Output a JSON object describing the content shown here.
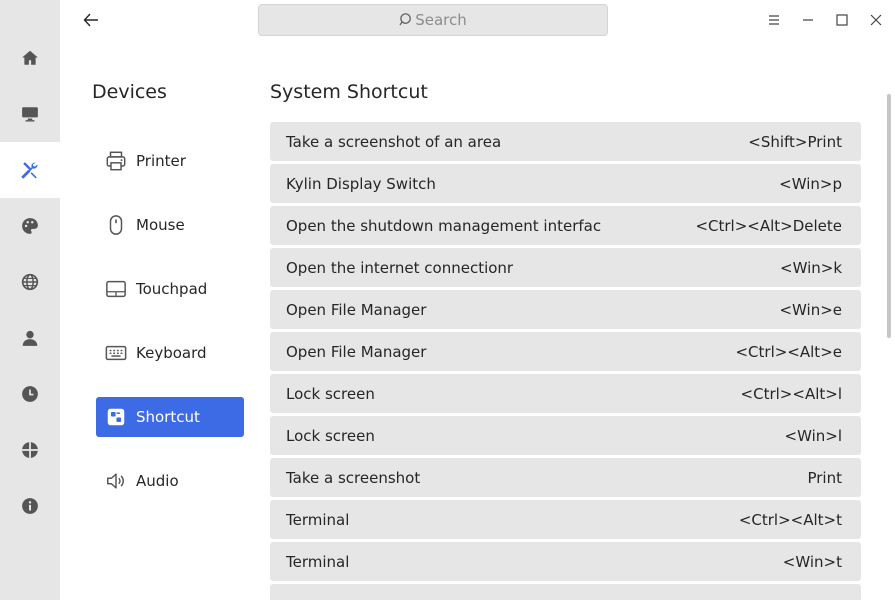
{
  "search": {
    "placeholder": "Search"
  },
  "rail": {
    "items": [
      {
        "icon": "home-icon"
      },
      {
        "icon": "monitor-icon"
      },
      {
        "icon": "tools-icon",
        "active": true
      },
      {
        "icon": "palette-icon"
      },
      {
        "icon": "globe-icon"
      },
      {
        "icon": "user-icon"
      },
      {
        "icon": "clock-icon"
      },
      {
        "icon": "update-icon"
      },
      {
        "icon": "info-icon"
      }
    ]
  },
  "devices": {
    "title": "Devices",
    "items": [
      {
        "label": "Printer",
        "icon": "printer-icon"
      },
      {
        "label": "Mouse",
        "icon": "mouse-icon"
      },
      {
        "label": "Touchpad",
        "icon": "touchpad-icon"
      },
      {
        "label": "Keyboard",
        "icon": "keyboard-icon"
      },
      {
        "label": "Shortcut",
        "icon": "shortcut-icon",
        "active": true
      },
      {
        "label": "Audio",
        "icon": "speaker-icon"
      }
    ]
  },
  "shortcuts": {
    "title": "System Shortcut",
    "rows": [
      {
        "name": "Take a screenshot of an area",
        "keys": "<Shift>Print"
      },
      {
        "name": "Kylin Display Switch",
        "keys": "<Win>p"
      },
      {
        "name": "Open the shutdown management interfac",
        "keys": "<Ctrl><Alt>Delete"
      },
      {
        "name": "Open the internet connectionr",
        "keys": "<Win>k"
      },
      {
        "name": "Open File Manager",
        "keys": "<Win>e"
      },
      {
        "name": "Open File Manager",
        "keys": "<Ctrl><Alt>e"
      },
      {
        "name": "Lock screen",
        "keys": "<Ctrl><Alt>l"
      },
      {
        "name": "Lock screen",
        "keys": "<Win>l"
      },
      {
        "name": "Take a screenshot",
        "keys": "Print"
      },
      {
        "name": "Terminal",
        "keys": "<Ctrl><Alt>t"
      },
      {
        "name": "Terminal",
        "keys": "<Win>t"
      },
      {
        "name": "",
        "keys": ""
      }
    ]
  },
  "colors": {
    "accent": "#3d6be5",
    "rail_bg": "#e6e6e6",
    "row_bg": "#e6e6e6"
  }
}
